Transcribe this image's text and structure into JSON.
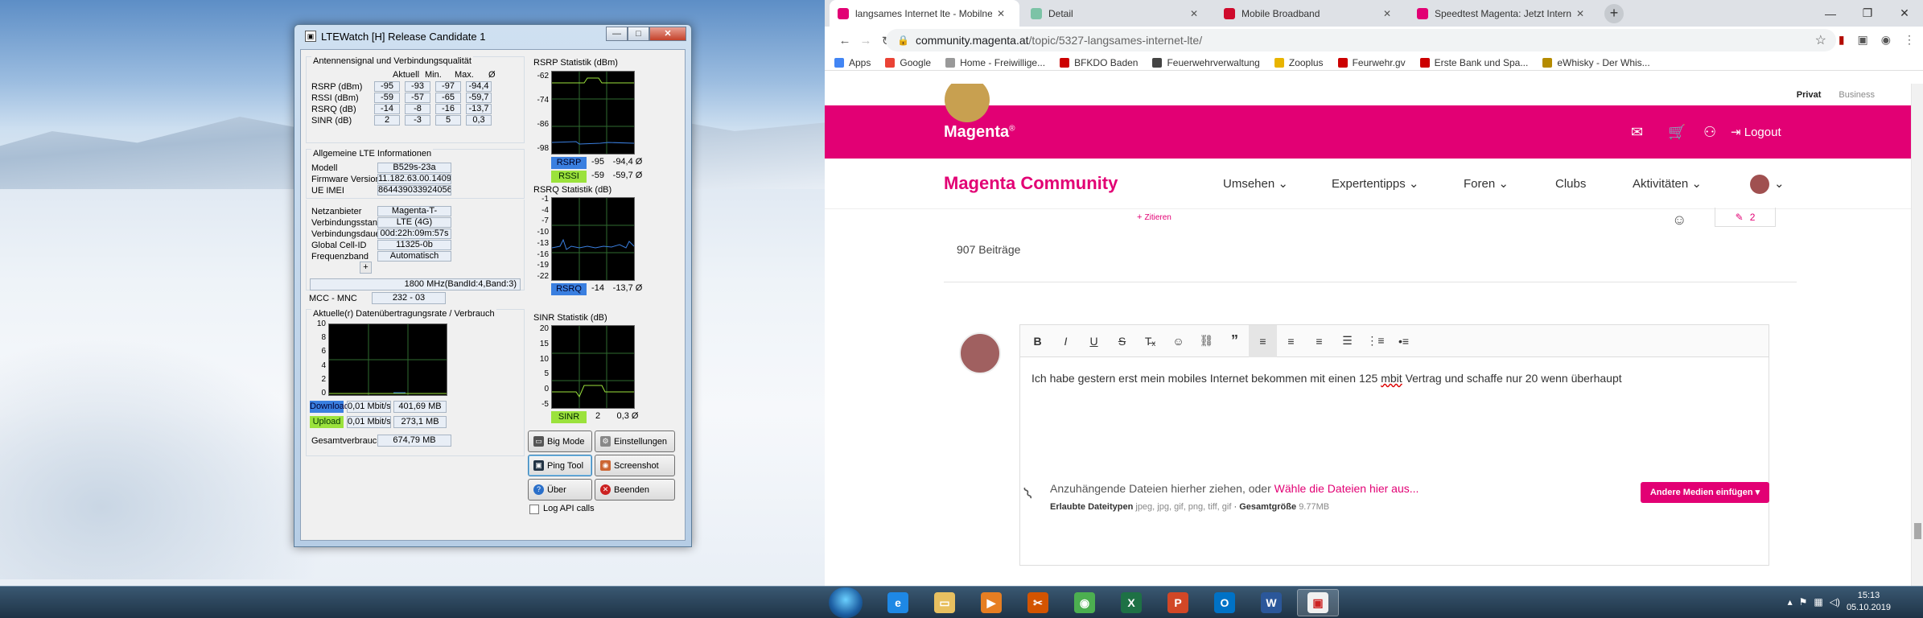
{
  "lte": {
    "window_title": "LTEWatch [H]   Release Candidate 1",
    "grp_signal": "Antennensignal und Verbindungsqualität",
    "cols": [
      "Aktuell",
      "Min.",
      "Max.",
      "Ø"
    ],
    "rows": [
      {
        "label": "RSRP (dBm)",
        "vals": [
          "-95",
          "-93",
          "-97",
          "-94,4"
        ]
      },
      {
        "label": "RSSI (dBm)",
        "vals": [
          "-59",
          "-57",
          "-65",
          "-59,7"
        ]
      },
      {
        "label": "RSRQ (dB)",
        "vals": [
          "-14",
          "-8",
          "-16",
          "-13,7"
        ]
      },
      {
        "label": "SINR (dB)",
        "vals": [
          "2",
          "-3",
          "5",
          "0,3"
        ]
      }
    ],
    "grp_info": "Allgemeine LTE Informationen",
    "info": [
      {
        "label": "Modell",
        "value": "B529s-23a"
      },
      {
        "label": "Firmware Version",
        "value": "11.182.63.00.1409"
      },
      {
        "label": "UE IMEI",
        "value": "864439033924056"
      }
    ],
    "net": [
      {
        "label": "Netzanbieter",
        "value": "Magenta-T-"
      },
      {
        "label": "Verbindungsstandard",
        "value": "LTE (4G)"
      },
      {
        "label": "Verbindungsdauer",
        "value": "00d:22h:09m:57s"
      },
      {
        "label": "Global Cell-ID",
        "value": "11325-0b"
      },
      {
        "label": "Frequenzband",
        "value": "Automatisch"
      }
    ],
    "freq_plus": "+",
    "band_detail": "1800 MHz(BandId:4,Band:3)",
    "mcc_label": "MCC - MNC",
    "mcc_value": "232 - 03",
    "grp_rate": "Aktuelle(r) Datenübertragungsrate / Verbrauch",
    "rate_ticks": [
      "10",
      "8",
      "6",
      "4",
      "2",
      "0"
    ],
    "download": {
      "label": "Download",
      "rate": "0,01 Mbit/s",
      "total": "401,69 MB"
    },
    "upload": {
      "label": "Upload",
      "rate": "0,01 Mbit/s",
      "total": "273,1 MB"
    },
    "total_label": "Gesamtverbrauch",
    "total_value": "674,79 MB",
    "rsrp_stat": {
      "title": "RSRP Statistik (dBm)",
      "ticks": [
        "-62",
        "-74",
        "-86",
        "-98"
      ],
      "chip1": "RSRP",
      "val1": "-95",
      "avg1": "-94,4 Ø",
      "chip2": "RSSI",
      "val2": "-59",
      "avg2": "-59,7 Ø"
    },
    "rsrq_stat": {
      "title": "RSRQ Statistik (dB)",
      "ticks": [
        "-1",
        "-4",
        "-7",
        "-10",
        "-13",
        "-16",
        "-19",
        "-22"
      ],
      "chip1": "RSRQ",
      "val1": "-14",
      "avg1": "-13,7 Ø"
    },
    "sinr_stat": {
      "title": "SINR Statistik (dB)",
      "ticks": [
        "20",
        "15",
        "10",
        "5",
        "0",
        "-5"
      ],
      "chip1": "SINR",
      "val1": "2",
      "avg1": "0,3 Ø"
    },
    "buttons": [
      "Big Mode",
      "Einstellungen",
      "Ping Tool",
      "Screenshot",
      "Über",
      "Beenden"
    ],
    "log_api": "Log API calls",
    "colors": {
      "rsrp": "#3a7fe0",
      "rssi": "#9be23c",
      "rsrq": "#3a7fe0",
      "sinr": "#9be23c",
      "download": "#3a7fe0",
      "upload": "#9be23c"
    }
  },
  "browser": {
    "tabs": [
      {
        "title": "langsames Internet lte - Mobilne",
        "icon": "telekom-icon",
        "color": "#e20074"
      },
      {
        "title": "Detail",
        "icon": "z-icon",
        "color": "#7cc3a6"
      },
      {
        "title": "Mobile Broadband",
        "icon": "huawei-icon",
        "color": "#cf0a2c"
      },
      {
        "title": "Speedtest Magenta: Jetzt Interne",
        "icon": "telekom-icon",
        "color": "#e20074"
      }
    ],
    "url_host": "community.magenta.at",
    "url_path": "/topic/5327-langsames-internet-lte/",
    "bookmarks": [
      "Apps",
      "Google",
      "Home - Freiwillige...",
      "BFKDO Baden",
      "Feuerwehrverwaltung",
      "Zooplus",
      "Feurwehr.gv",
      "Erste Bank und Spa...",
      "eWhisky - Der Whis..."
    ]
  },
  "site": {
    "top_links": [
      "Privat",
      "Business"
    ],
    "brand": "Magenta",
    "brand_mark": "®",
    "logout": "Logout",
    "community_title": "Magenta Community",
    "nav": [
      "Umsehen",
      "Expertentipps",
      "Foren",
      "Clubs",
      "Aktivitäten"
    ],
    "quote_label": "Zitieren",
    "reply_count": "2",
    "post_count": "907 Beiträge",
    "editor_text_1": "Ich habe gestern erst mein mobiles Internet bekommen mit einen 125 ",
    "editor_text_spell": "mbit",
    "editor_text_2": " Vertrag und schaffe nur 20 wenn überhaupt",
    "upload_text": "Anzuhängende Dateien hierher ziehen, oder ",
    "upload_link": "Wähle die Dateien hier aus...",
    "allowed_label": "Erlaubte Dateitypen",
    "allowed_types": "jpeg, jpg, gif, png, tiff, gif",
    "size_label": "Gesamtgröße",
    "size_value": "9.77MB",
    "media_button": "Andere Medien einfügen ▾"
  },
  "taskbar": {
    "time": "15:13",
    "date": "05.10.2019",
    "apps": [
      "explorer",
      "ie",
      "folder",
      "media",
      "snip",
      "chrome",
      "excel",
      "powerpoint",
      "outlook",
      "word",
      "ltewatch"
    ]
  }
}
